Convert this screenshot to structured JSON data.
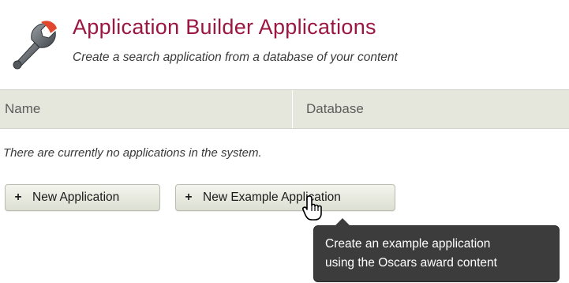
{
  "header": {
    "title": "Application Builder Applications",
    "subtitle": "Create a search application from a database of your content",
    "icon": "wrench-icon",
    "title_color": "#9b1742"
  },
  "table": {
    "columns": [
      "Name",
      "Database"
    ],
    "empty_message": "There are currently no applications in the system."
  },
  "buttons": {
    "new_application": {
      "icon": "+",
      "label": "New Application"
    },
    "new_example_application": {
      "icon": "+",
      "label": "New Example Application"
    }
  },
  "tooltip": {
    "lines": [
      "Create an example application",
      "using the Oscars award content"
    ]
  },
  "cursor": {
    "icon": "hand-pointer-icon"
  }
}
